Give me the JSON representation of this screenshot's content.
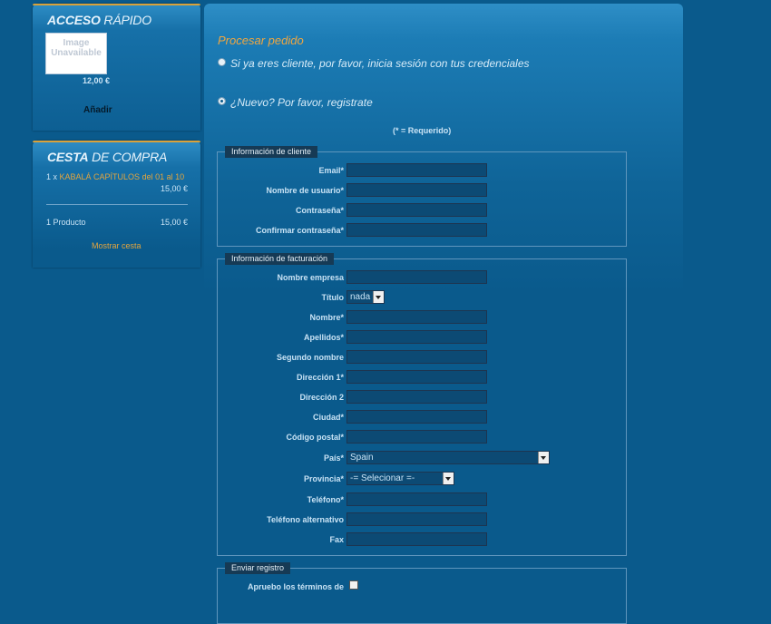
{
  "quick_access": {
    "title_bold": "Acceso",
    "title_light": "rápido",
    "image_alt": "Image Unavailable",
    "price": "12,00 €",
    "add_label": "Añadir"
  },
  "cart": {
    "title_bold": "Cesta",
    "title_light": "de compra",
    "item_qty": "1 x",
    "item_name": "KABALÁ CAPÍTULOS del 01 al 10",
    "item_price": "15,00 €",
    "count": "1 Producto",
    "total": "15,00 €",
    "show_cart": "Mostrar cesta"
  },
  "checkout": {
    "title": "Procesar pedido",
    "login_option": "Si ya eres cliente, por favor, inicia sesión con tus credenciales",
    "register_option": "¿Nuevo? Por favor, registrate",
    "required_note": "(* = Requerido)"
  },
  "customer_info": {
    "legend": "Información de cliente",
    "email": "Email*",
    "username": "Nombre de usuario*",
    "password": "Contraseña*",
    "confirm_password": "Confirmar contraseña*"
  },
  "billing_info": {
    "legend": "Información de facturación",
    "company": "Nombre empresa",
    "title_label": "Título",
    "title_value": "nada",
    "first_name": "Nombre*",
    "last_name": "Apellidos*",
    "middle_name": "Segundo nombre",
    "address1": "Dirección 1*",
    "address2": "Dirección 2",
    "city": "Ciudad*",
    "zip": "Código postal*",
    "country": "País*",
    "country_value": "Spain",
    "province": "Provincia*",
    "province_value": "-= Selecionar =-",
    "phone": "Teléfono*",
    "alt_phone": "Teléfono alternativo",
    "fax": "Fax"
  },
  "submit_registration": {
    "legend": "Enviar registro",
    "terms": "Apruebo los términos de"
  }
}
